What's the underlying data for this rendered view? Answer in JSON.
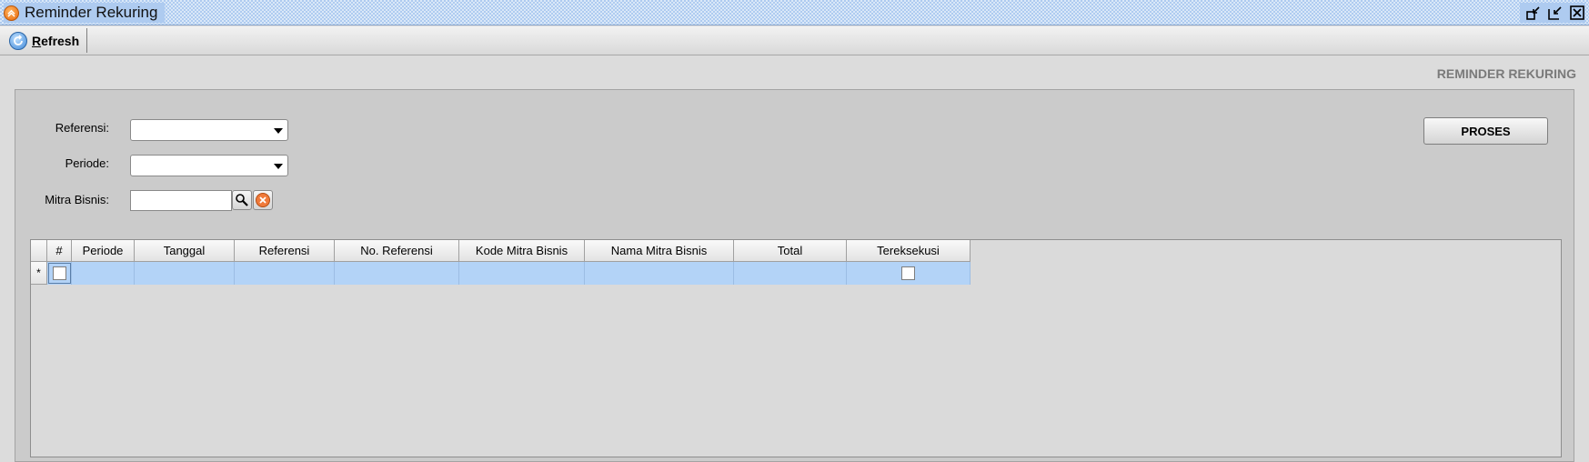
{
  "window": {
    "title": "Reminder Rekuring",
    "app_icon": "chevron-up-icon",
    "controls": [
      "restore-down-icon",
      "maximize-icon",
      "close-icon"
    ]
  },
  "toolbar": {
    "refresh_mnemonic": "R",
    "refresh_rest": "efresh",
    "refresh_icon": "refresh-icon"
  },
  "form": {
    "heading": "REMINDER REKURING",
    "referensi_label": "Referensi:",
    "referensi_value": "",
    "periode_label": "Periode:",
    "periode_value": "",
    "mitra_label": "Mitra Bisnis:",
    "mitra_value": "",
    "search_icon": "search-icon",
    "clear_icon": "clear-icon",
    "proses_label": "PROSES"
  },
  "grid": {
    "columns": [
      "#",
      "Periode",
      "Tanggal",
      "Referensi",
      "No. Referensi",
      "Kode Mitra Bisnis",
      "Nama Mitra Bisnis",
      "Total",
      "Tereksekusi"
    ],
    "new_row_marker": "*",
    "rows": [
      {
        "selected": false,
        "periode": "",
        "tanggal": "",
        "referensi": "",
        "no_referensi": "",
        "kode_mitra": "",
        "nama_mitra": "",
        "total": "",
        "tereksekusi": false
      }
    ]
  },
  "colors": {
    "titlebar": "#aecbf0",
    "row_highlight": "#b3d3f7",
    "background": "#dcdcdc",
    "panel": "#cbcbcb"
  }
}
